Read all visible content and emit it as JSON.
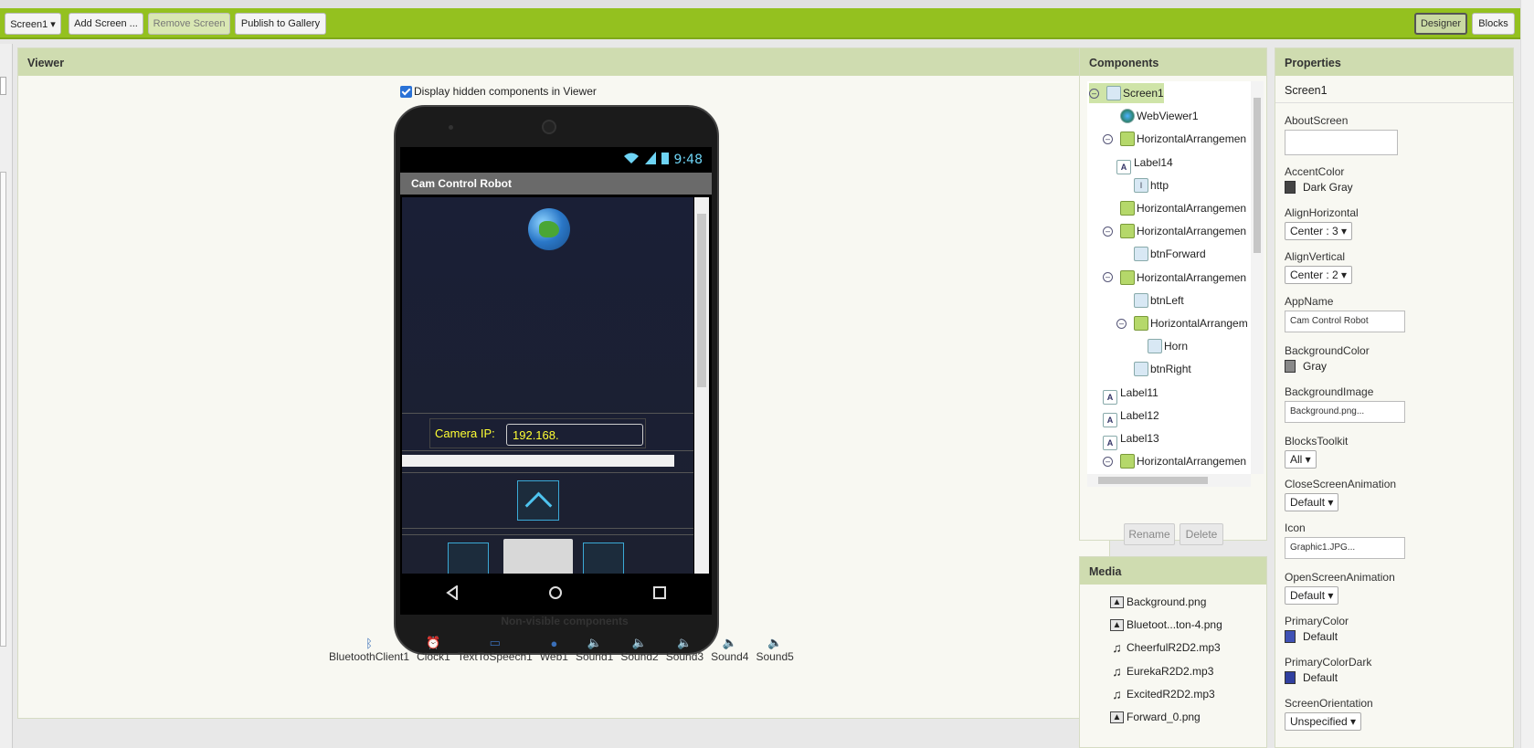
{
  "toolbar": {
    "screen_select": "Screen1 ▾",
    "add_screen": "Add Screen ...",
    "remove_screen": "Remove Screen",
    "publish": "Publish to Gallery",
    "designer": "Designer",
    "blocks": "Blocks"
  },
  "viewer": {
    "title": "Viewer",
    "hidden_checkbox_label": "Display hidden components in Viewer",
    "phone": {
      "time": "9:48",
      "app_title": "Cam Control Robot",
      "camera_label": "Camera IP:",
      "camera_ip": "192.168."
    },
    "nonvisible_title": "Non-visible components",
    "nonvisible": [
      {
        "label": "BluetoothClient1",
        "icon": "bluetooth-icon"
      },
      {
        "label": "Clock1",
        "icon": "clock-icon"
      },
      {
        "label": "TextToSpeech1",
        "icon": "speech-icon"
      },
      {
        "label": "Web1",
        "icon": "web-icon"
      },
      {
        "label": "Sound1",
        "icon": "sound-icon"
      },
      {
        "label": "Sound2",
        "icon": "sound-icon"
      },
      {
        "label": "Sound3",
        "icon": "sound-icon"
      },
      {
        "label": "Sound4",
        "icon": "sound-icon"
      },
      {
        "label": "Sound5",
        "icon": "sound-icon"
      }
    ]
  },
  "components": {
    "title": "Components",
    "tree": [
      {
        "label": "Screen1",
        "toggle": "⊖",
        "icon": "screen"
      },
      {
        "label": "WebViewer1",
        "toggle": "",
        "icon": "webviewer"
      },
      {
        "label": "HorizontalArrangemen",
        "toggle": "⊖",
        "icon": "arrangement"
      },
      {
        "label": "Label14",
        "toggle": "",
        "icon": "label"
      },
      {
        "label": "http",
        "toggle": "",
        "icon": "textbox"
      },
      {
        "label": "HorizontalArrangemen",
        "toggle": "",
        "icon": "arrangement"
      },
      {
        "label": "HorizontalArrangemen",
        "toggle": "⊖",
        "icon": "arrangement"
      },
      {
        "label": "btnForward",
        "toggle": "",
        "icon": "button"
      },
      {
        "label": "HorizontalArrangemen",
        "toggle": "⊖",
        "icon": "arrangement"
      },
      {
        "label": "btnLeft",
        "toggle": "",
        "icon": "button"
      },
      {
        "label": "HorizontalArrangem",
        "toggle": "⊖",
        "icon": "arrangement"
      },
      {
        "label": "Horn",
        "toggle": "",
        "icon": "button"
      },
      {
        "label": "btnRight",
        "toggle": "",
        "icon": "button"
      },
      {
        "label": "Label11",
        "toggle": "",
        "icon": "label"
      },
      {
        "label": "Label12",
        "toggle": "",
        "icon": "label"
      },
      {
        "label": "Label13",
        "toggle": "",
        "icon": "label"
      },
      {
        "label": "HorizontalArrangemen",
        "toggle": "⊖",
        "icon": "arrangement"
      }
    ],
    "rename": "Rename",
    "delete": "Delete"
  },
  "media": {
    "title": "Media",
    "items": [
      {
        "label": "Background.png",
        "icon": "image-icon"
      },
      {
        "label": "Bluetoot...ton-4.png",
        "icon": "image-icon"
      },
      {
        "label": "CheerfulR2D2.mp3",
        "icon": "music-icon"
      },
      {
        "label": "EurekaR2D2.mp3",
        "icon": "music-icon"
      },
      {
        "label": "ExcitedR2D2.mp3",
        "icon": "music-icon"
      },
      {
        "label": "Forward_0.png",
        "icon": "image-icon"
      }
    ]
  },
  "properties": {
    "title": "Properties",
    "screen": "Screen1",
    "about_label": "AboutScreen",
    "about_value": "",
    "accent_label": "AccentColor",
    "accent_value": "Dark Gray",
    "accent_color": "#444444",
    "alignh_label": "AlignHorizontal",
    "alignh_value": "Center : 3 ▾",
    "alignv_label": "AlignVertical",
    "alignv_value": "Center : 2 ▾",
    "appname_label": "AppName",
    "appname_value": "Cam Control Robot",
    "bgcolor_label": "BackgroundColor",
    "bgcolor_value": "Gray",
    "bgcolor_color": "#888888",
    "bgimage_label": "BackgroundImage",
    "bgimage_value": "Background.png...",
    "blocks_label": "BlocksToolkit",
    "blocks_value": "All ▾",
    "close_label": "CloseScreenAnimation",
    "close_value": "Default ▾",
    "icon_label": "Icon",
    "icon_value": "Graphic1.JPG...",
    "open_label": "OpenScreenAnimation",
    "open_value": "Default ▾",
    "primary_label": "PrimaryColor",
    "primary_value": "Default",
    "primary_color": "#3f51b5",
    "primarydark_label": "PrimaryColorDark",
    "primarydark_value": "Default",
    "primarydark_color": "#303f9f",
    "orient_label": "ScreenOrientation",
    "orient_value": "Unspecified ▾"
  },
  "colors": {
    "toolbar_green": "#94c11f",
    "panel_header": "#cfdcb0"
  }
}
